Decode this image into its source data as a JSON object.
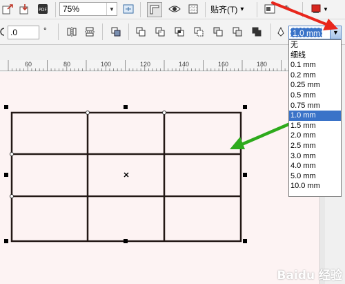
{
  "toolbar": {
    "zoom_value": "75%",
    "snap_label": "贴齐(T)",
    "snap_arrow": "▾"
  },
  "property_bar": {
    "angle_value": ".0",
    "angle_unit": "°",
    "outline_width_value": "1.0 mm"
  },
  "ruler": {
    "tick_labels": [
      "60",
      "80",
      "100",
      "120",
      "140",
      "160",
      "180"
    ]
  },
  "outline_width_options": [
    "无",
    "细线",
    "0.1 mm",
    "0.2 mm",
    "0.25 mm",
    "0.5 mm",
    "0.75 mm",
    "1.0 mm",
    "1.5 mm",
    "2.0 mm",
    "2.5 mm",
    "3.0 mm",
    "4.0 mm",
    "5.0 mm",
    "10.0 mm"
  ],
  "selected_option": "1.0 mm",
  "watermark": "Baidu 经验",
  "colors": {
    "selection_blue": "#3a73c8",
    "canvas_bg": "#fdf3f3",
    "annotation_red": "#e8261c",
    "annotation_green": "#2eaa1c",
    "table_line": "#231815"
  },
  "icons": {
    "export": "export-icon",
    "import": "import-icon",
    "pdf": "pdf-icon",
    "fullscreen": "fullscreen-icon",
    "rulers": "rulers-icon",
    "view": "eye-icon",
    "grid": "grid-icon",
    "options": "options-icon",
    "app_launcher": "app-launcher-icon"
  }
}
